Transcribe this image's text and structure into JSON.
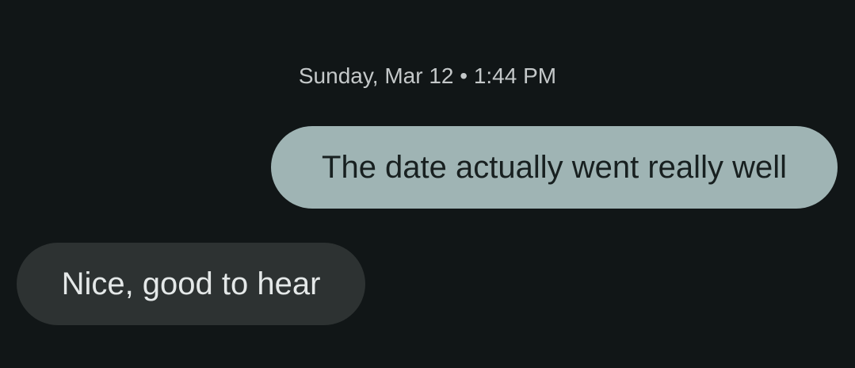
{
  "conversation": {
    "timestamp": "Sunday, Mar 12 • 1:44 PM",
    "messages": [
      {
        "direction": "outgoing",
        "text": "The date actually went really well"
      },
      {
        "direction": "incoming",
        "text": "Nice, good to hear"
      }
    ]
  },
  "colors": {
    "background": "#111617",
    "outgoing_bubble": "#9fb4b4",
    "incoming_bubble": "#2d3232",
    "timestamp_text": "#c4c8c9"
  }
}
